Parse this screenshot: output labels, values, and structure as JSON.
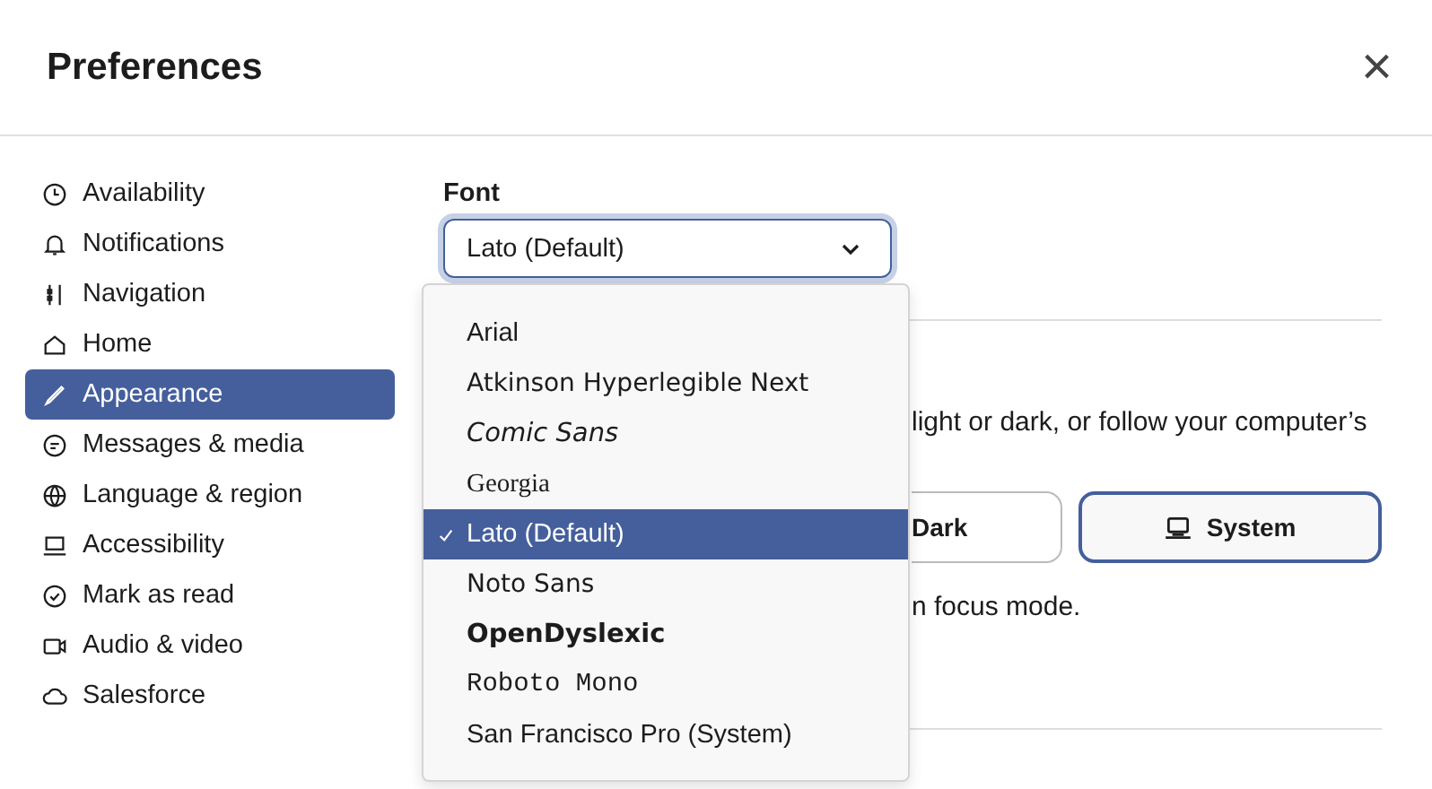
{
  "dialog": {
    "title": "Preferences",
    "close_label": "×"
  },
  "sidebar": {
    "items": [
      {
        "label": "Availability",
        "selected": false
      },
      {
        "label": "Notifications",
        "selected": false
      },
      {
        "label": "Navigation",
        "selected": false
      },
      {
        "label": "Home",
        "selected": false
      },
      {
        "label": "Appearance",
        "selected": true
      },
      {
        "label": "Messages & media",
        "selected": false
      },
      {
        "label": "Language & region",
        "selected": false
      },
      {
        "label": "Accessibility",
        "selected": false
      },
      {
        "label": "Mark as read",
        "selected": false
      },
      {
        "label": "Audio & video",
        "selected": false
      },
      {
        "label": "Salesforce",
        "selected": false
      }
    ]
  },
  "font_setting": {
    "label": "Font",
    "value": "Lato (Default)",
    "expanded": true,
    "options": [
      {
        "label": "Arial",
        "selected": false
      },
      {
        "label": "Atkinson Hyperlegible Next",
        "selected": false
      },
      {
        "label": "Comic Sans",
        "selected": false
      },
      {
        "label": "Georgia",
        "selected": false
      },
      {
        "label": "Lato (Default)",
        "selected": true
      },
      {
        "label": "Noto Sans",
        "selected": false
      },
      {
        "label": "OpenDyslexic",
        "selected": false
      },
      {
        "label": "Roboto Mono",
        "selected": false
      },
      {
        "label": "San Francisco Pro (System)",
        "selected": false
      }
    ]
  },
  "theme": {
    "description": "light or dark, or follow your computer’s",
    "options": [
      {
        "label": "Dark",
        "selected": false
      },
      {
        "label": "System",
        "selected": true
      }
    ],
    "note": "n focus mode."
  }
}
